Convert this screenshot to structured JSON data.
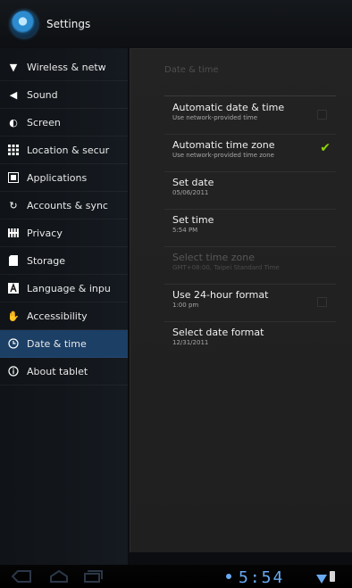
{
  "app": {
    "title": "Settings",
    "icon": "settings-app-icon"
  },
  "sidebar": {
    "items": [
      {
        "label": "Wireless & netw",
        "icon": "wifi-icon",
        "selected": false
      },
      {
        "label": "Sound",
        "icon": "speaker-icon",
        "selected": false
      },
      {
        "label": "Screen",
        "icon": "brightness-icon",
        "selected": false
      },
      {
        "label": "Location & secur",
        "icon": "grid-icon",
        "selected": false
      },
      {
        "label": "Applications",
        "icon": "applications-icon",
        "selected": false
      },
      {
        "label": "Accounts & sync",
        "icon": "sync-icon",
        "selected": false
      },
      {
        "label": "Privacy",
        "icon": "privacy-icon",
        "selected": false
      },
      {
        "label": "Storage",
        "icon": "storage-icon",
        "selected": false
      },
      {
        "label": "Language & inpu",
        "icon": "language-icon",
        "selected": false
      },
      {
        "label": "Accessibility",
        "icon": "accessibility-icon",
        "selected": true
      },
      {
        "label": "Date & time",
        "icon": "clock-icon",
        "selected": false
      },
      {
        "label": "About tablet",
        "icon": "info-icon",
        "selected": false
      }
    ]
  },
  "content": {
    "header": "Date & time",
    "settings": [
      {
        "title": "Automatic date & time",
        "summary": "Use network-provided time",
        "control": "checkbox",
        "checked": false,
        "enabled": true
      },
      {
        "title": "Automatic time zone",
        "summary": "Use network-provided time zone",
        "control": "checkbox",
        "checked": true,
        "enabled": true
      },
      {
        "title": "Set date",
        "summary": "05/06/2011",
        "control": "none",
        "enabled": true
      },
      {
        "title": "Set time",
        "summary": "5:54 PM",
        "control": "none",
        "enabled": true
      },
      {
        "title": "Select time zone",
        "summary": "GMT+08:00, Taipei Standard Time",
        "control": "none",
        "enabled": false
      },
      {
        "title": "Use 24-hour format",
        "summary": "1:00 pm",
        "control": "checkbox",
        "checked": false,
        "enabled": true
      },
      {
        "title": "Select date format",
        "summary": "12/31/2011",
        "control": "none",
        "enabled": true
      }
    ]
  },
  "status_bar": {
    "time": "5:54",
    "colors": {
      "accent": "#6aaaf2"
    }
  },
  "colors": {
    "selected_item_bg": "#1c3f66",
    "check_green": "#8fd400"
  }
}
